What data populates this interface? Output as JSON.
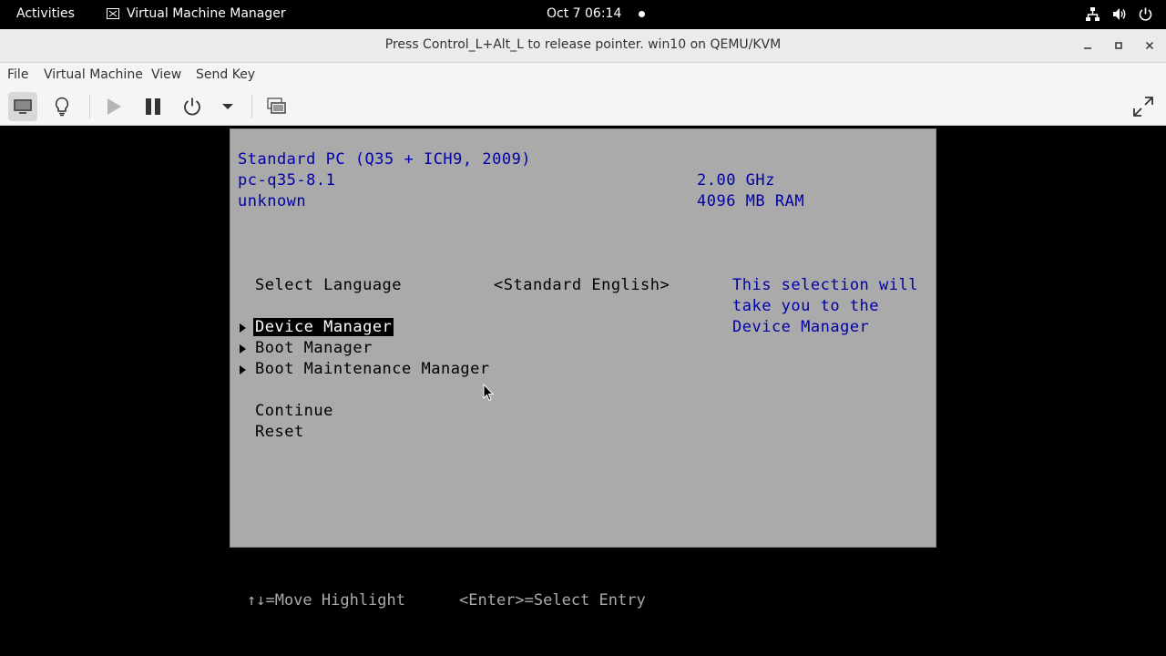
{
  "topbar": {
    "activities": "Activities",
    "app_name": "Virtual Machine Manager",
    "clock": "Oct 7  06:14",
    "tray_icons": [
      "network-icon",
      "volume-icon",
      "power-icon"
    ]
  },
  "window": {
    "title": "Press Control_L+Alt_L to release pointer. win10 on QEMU/KVM"
  },
  "menubar": {
    "file": "File",
    "virtual_machine": "Virtual Machine",
    "view": "View",
    "send_key": "Send Key"
  },
  "toolbar": {
    "buttons": [
      "console-icon",
      "details-bulb-icon",
      "run-icon",
      "pause-icon",
      "shutdown-icon",
      "shutdown-menu-chevron-icon",
      "snapshots-icon",
      "fullscreen-icon"
    ]
  },
  "bios": {
    "machine": "Standard PC (Q35 + ICH9, 2009)",
    "machine_type": "pc-q35-8.1",
    "version": "unknown",
    "cpu": "2.00 GHz",
    "ram": "4096 MB RAM",
    "language_label": "Select Language",
    "language_value": "<Standard English>",
    "help_line1": "This selection will",
    "help_line2": "take you to the",
    "help_line3": "Device Manager",
    "menu": [
      "Device Manager",
      "Boot Manager",
      "Boot Maintenance Manager"
    ],
    "continue": "Continue",
    "reset": "Reset",
    "footer_move": "↑↓=Move Highlight",
    "footer_select": "<Enter>=Select Entry"
  },
  "colors": {
    "bios_background": "#aaaaaa",
    "bios_blue": "#0000a8",
    "highlight_bg": "#000000"
  }
}
